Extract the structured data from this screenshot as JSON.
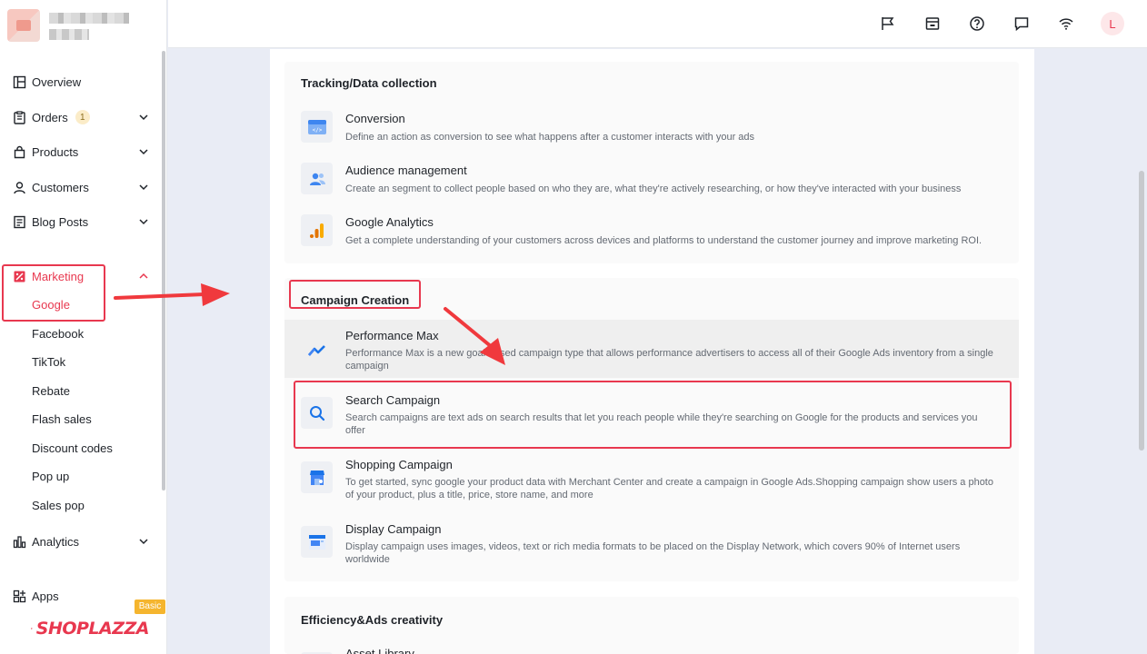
{
  "sidebar": {
    "nav": [
      {
        "label": "Overview"
      },
      {
        "label": "Orders",
        "badge": "1"
      },
      {
        "label": "Products"
      },
      {
        "label": "Customers"
      },
      {
        "label": "Blog Posts"
      },
      {
        "label": "Marketing"
      },
      {
        "label": "Analytics"
      },
      {
        "label": "Apps"
      }
    ],
    "marketing_sub": [
      "Google",
      "Facebook",
      "TikTok",
      "Rebate",
      "Flash sales",
      "Discount codes",
      "Pop up",
      "Sales pop"
    ],
    "brand": "SHOPLAZZA",
    "plan_badge": "Basic"
  },
  "topbar": {
    "avatar_letter": "L",
    "icons": [
      "flag-icon",
      "store-icon",
      "help-icon",
      "message-icon",
      "wifi-icon"
    ]
  },
  "sections": [
    {
      "title": "Tracking/Data collection",
      "items": [
        {
          "title": "Conversion",
          "desc": "Define an action as conversion to see what happens after a customer interacts with your ads"
        },
        {
          "title": "Audience management",
          "desc": "Create an segment to collect people based on who they are, what they're actively researching, or how they've interacted with your business"
        },
        {
          "title": "Google Analytics",
          "desc": "Get a complete understanding of your customers across devices and platforms to understand the customer journey and improve marketing ROI."
        }
      ]
    },
    {
      "title": "Campaign Creation",
      "items": [
        {
          "title": "Performance Max",
          "desc": "Performance Max is a new goal-based campaign type that allows performance advertisers to access all of their Google Ads inventory from a single campaign"
        },
        {
          "title": "Search Campaign",
          "desc": "Search campaigns are text ads on search results that let you reach people while they're searching on Google for the products and services you offer"
        },
        {
          "title": "Shopping Campaign",
          "desc": "To get started, sync google your product data with Merchant Center and create a campaign in Google Ads.Shopping campaign show users a photo of your product, plus a title, price, store name, and more"
        },
        {
          "title": "Display Campaign",
          "desc": "Display campaign uses images, videos, text or rich media formats to be placed on the Display Network, which covers 90% of Internet users worldwide"
        }
      ]
    },
    {
      "title": "Efficiency&Ads creativity",
      "items": [
        {
          "title": "Asset Library"
        }
      ]
    }
  ],
  "colors": {
    "accent": "#e8384f",
    "annotation": "#f0393d"
  }
}
